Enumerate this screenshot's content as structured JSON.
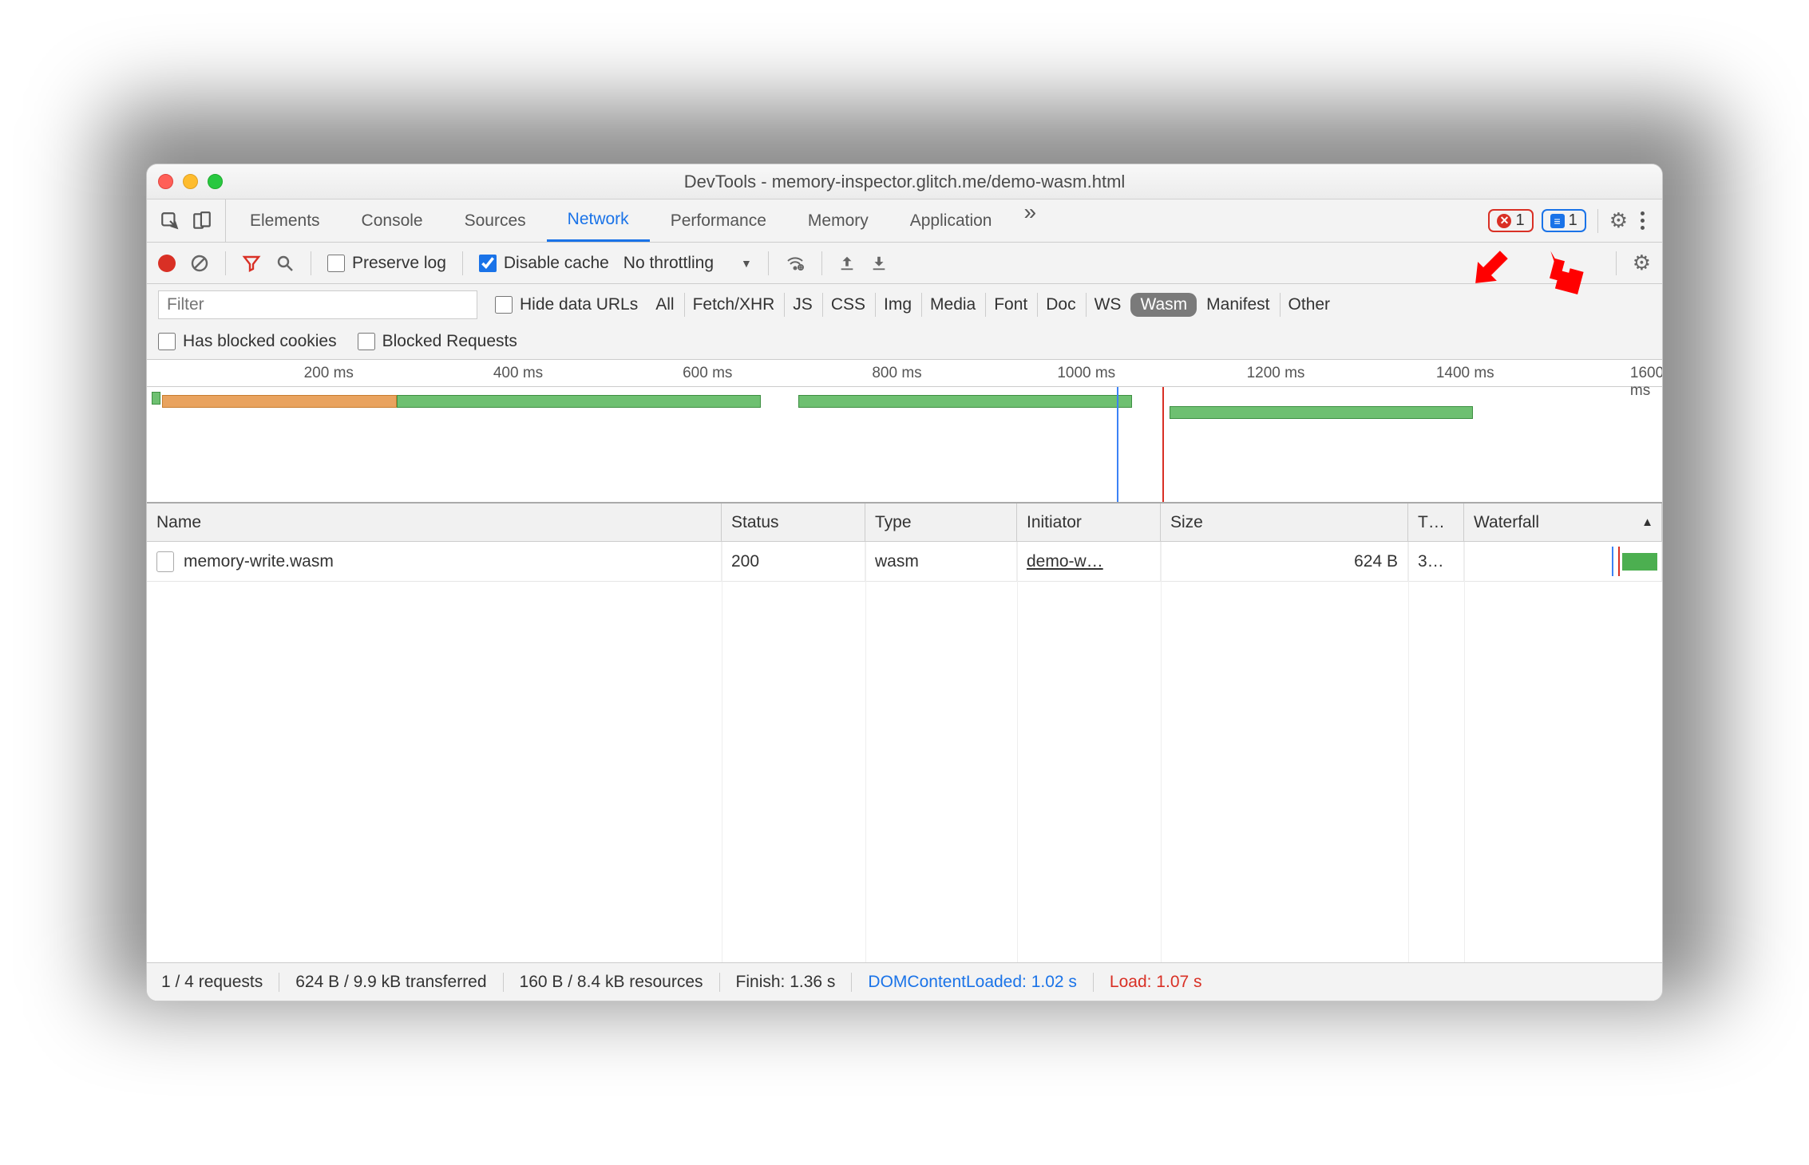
{
  "title": "DevTools - memory-inspector.glitch.me/demo-wasm.html",
  "tabs": [
    "Elements",
    "Console",
    "Sources",
    "Network",
    "Performance",
    "Memory",
    "Application"
  ],
  "active_tab": "Network",
  "badges": {
    "error_count": "1",
    "message_count": "1"
  },
  "toolbar": {
    "preserve_log": "Preserve log",
    "disable_cache": "Disable cache",
    "throttling": "No throttling"
  },
  "filter": {
    "placeholder": "Filter",
    "hide_data_urls": "Hide data URLs",
    "types": [
      "All",
      "Fetch/XHR",
      "JS",
      "CSS",
      "Img",
      "Media",
      "Font",
      "Doc",
      "WS",
      "Wasm",
      "Manifest",
      "Other"
    ],
    "selected_type": "Wasm",
    "has_blocked_cookies": "Has blocked cookies",
    "blocked_requests": "Blocked Requests"
  },
  "overview": {
    "ticks": [
      "200 ms",
      "400 ms",
      "600 ms",
      "800 ms",
      "1000 ms",
      "1200 ms",
      "1400 ms",
      "1600 ms"
    ]
  },
  "columns": {
    "name": "Name",
    "status": "Status",
    "type": "Type",
    "initiator": "Initiator",
    "size": "Size",
    "time": "T…",
    "waterfall": "Waterfall"
  },
  "rows": [
    {
      "name": "memory-write.wasm",
      "status": "200",
      "type": "wasm",
      "initiator": "demo-w…",
      "size": "624 B",
      "time": "3…"
    }
  ],
  "status": {
    "requests": "1 / 4 requests",
    "transferred": "624 B / 9.9 kB transferred",
    "resources": "160 B / 8.4 kB resources",
    "finish": "Finish: 1.36 s",
    "dcl": "DOMContentLoaded: 1.02 s",
    "load": "Load: 1.07 s"
  }
}
